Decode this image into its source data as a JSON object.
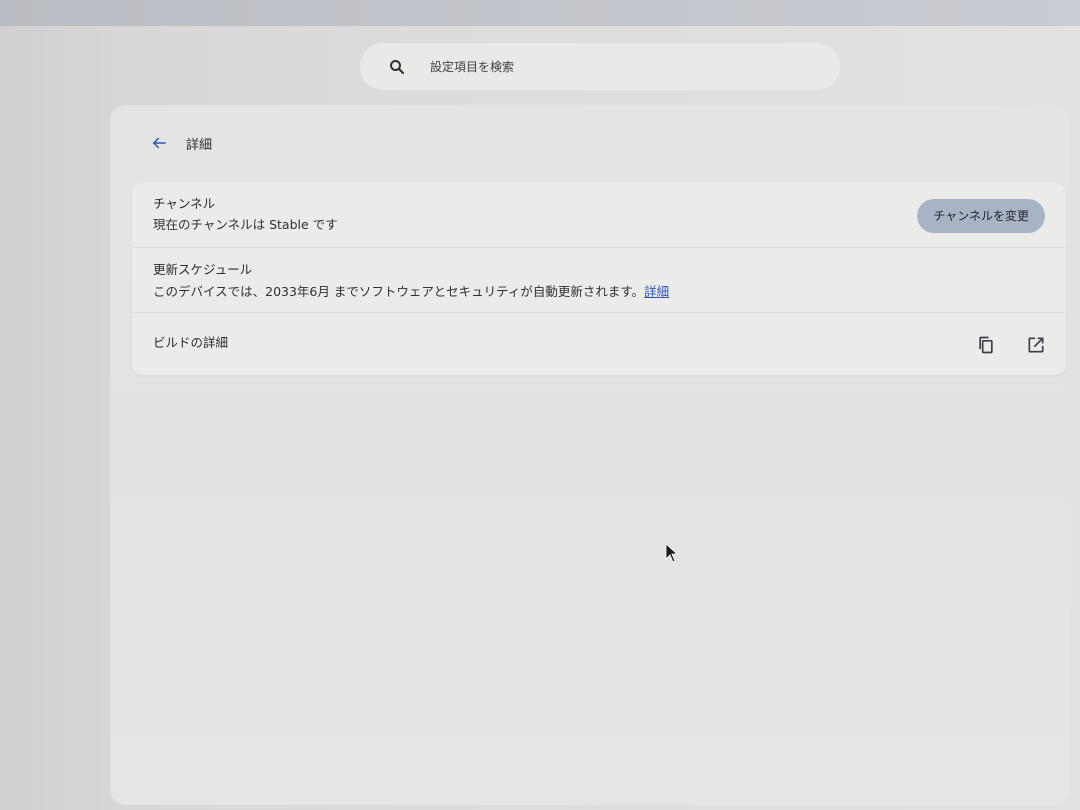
{
  "search": {
    "placeholder": "設定項目を検索",
    "icon": "search-icon"
  },
  "header": {
    "back_icon": "arrow-left-icon",
    "title": "詳細"
  },
  "channel": {
    "title": "チャンネル",
    "subtitle": "現在のチャンネルは Stable です",
    "button_label": "チャンネルを変更"
  },
  "schedule": {
    "title": "更新スケジュール",
    "subtitle": "このデバイスでは、2033年6月 までソフトウェアとセキュリティが自動更新されます。",
    "link_label": "詳細"
  },
  "build": {
    "title": "ビルドの詳細",
    "copy_icon": "copy-icon",
    "open_icon": "open-in-new-icon"
  },
  "colors": {
    "accent": "#2c55b4",
    "button_bg": "#a8b4c5",
    "icon": "#3a3d44"
  }
}
